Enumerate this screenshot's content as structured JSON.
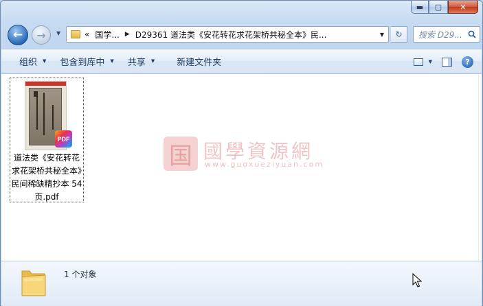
{
  "window": {
    "minimize_label": "▬",
    "maximize_label": "▢",
    "close_label": "✕"
  },
  "nav": {
    "back_glyph": "←",
    "forward_glyph": "→",
    "history_dropdown_glyph": "▼"
  },
  "address": {
    "overflow_chevron": "«",
    "crumb_1": "国学...",
    "separator": "▶",
    "crumb_2": "D29361 道法类《安花转花求花架桥共秘全本》民...",
    "dropdown_glyph": "▼"
  },
  "refresh_glyph": "↻",
  "search": {
    "placeholder": "搜索 D29..."
  },
  "toolbar": {
    "organize": "组织",
    "include_in_library": "包含到库中",
    "share": "共享",
    "new_folder": "新建文件夹",
    "dropdown_glyph": "▼",
    "help_glyph": "?"
  },
  "file": {
    "name": "道法类《安花转花求花架桥共秘全本》民间稀缺精抄本 54页.pdf",
    "badge": "PDF",
    "type": "pdf"
  },
  "watermark": {
    "logo_char": "国",
    "title": "國學資源網",
    "url": "www.guoxueziyuan.com"
  },
  "status": {
    "object_count": "1 个对象"
  }
}
